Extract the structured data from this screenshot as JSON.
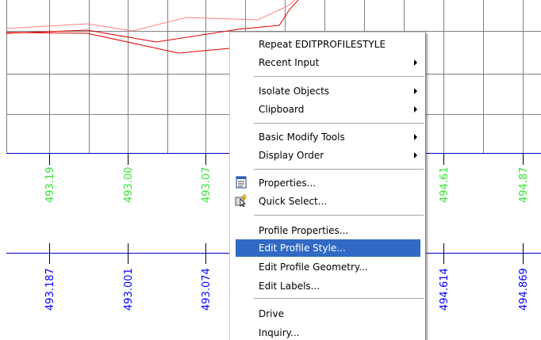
{
  "colors": {
    "grid": "#808080",
    "datum": "#0000cc",
    "profile_red": "#e00000",
    "profile_pink": "#ff8080",
    "existing_elev_text": "#33e633",
    "design_elev_text": "#0000ff",
    "menu_highlight": "#316ac5"
  },
  "profile_view": {
    "existing_elevations": [
      "493.19",
      "493.00",
      "493.07",
      "494.61",
      "494.87"
    ],
    "design_elevations": [
      "493.187",
      "493.001",
      "493.074",
      "494.614",
      "494.869"
    ]
  },
  "context_menu": {
    "items": [
      {
        "label": "Repeat EDITPROFILESTYLE",
        "has_submenu": false
      },
      {
        "label": "Recent Input",
        "has_submenu": true
      },
      {
        "label": "Isolate Objects",
        "has_submenu": true
      },
      {
        "label": "Clipboard",
        "has_submenu": true
      },
      {
        "label": "Basic Modify Tools",
        "has_submenu": true
      },
      {
        "label": "Display Order",
        "has_submenu": true
      },
      {
        "label": "Properties...",
        "icon": "properties-icon"
      },
      {
        "label": "Quick Select...",
        "icon": "quick-select-icon"
      },
      {
        "label": "Profile Properties..."
      },
      {
        "label": "Edit Profile Style...",
        "highlighted": true
      },
      {
        "label": "Edit Profile Geometry..."
      },
      {
        "label": "Edit Labels..."
      },
      {
        "label": "Drive"
      },
      {
        "label": "Inquiry..."
      }
    ]
  }
}
